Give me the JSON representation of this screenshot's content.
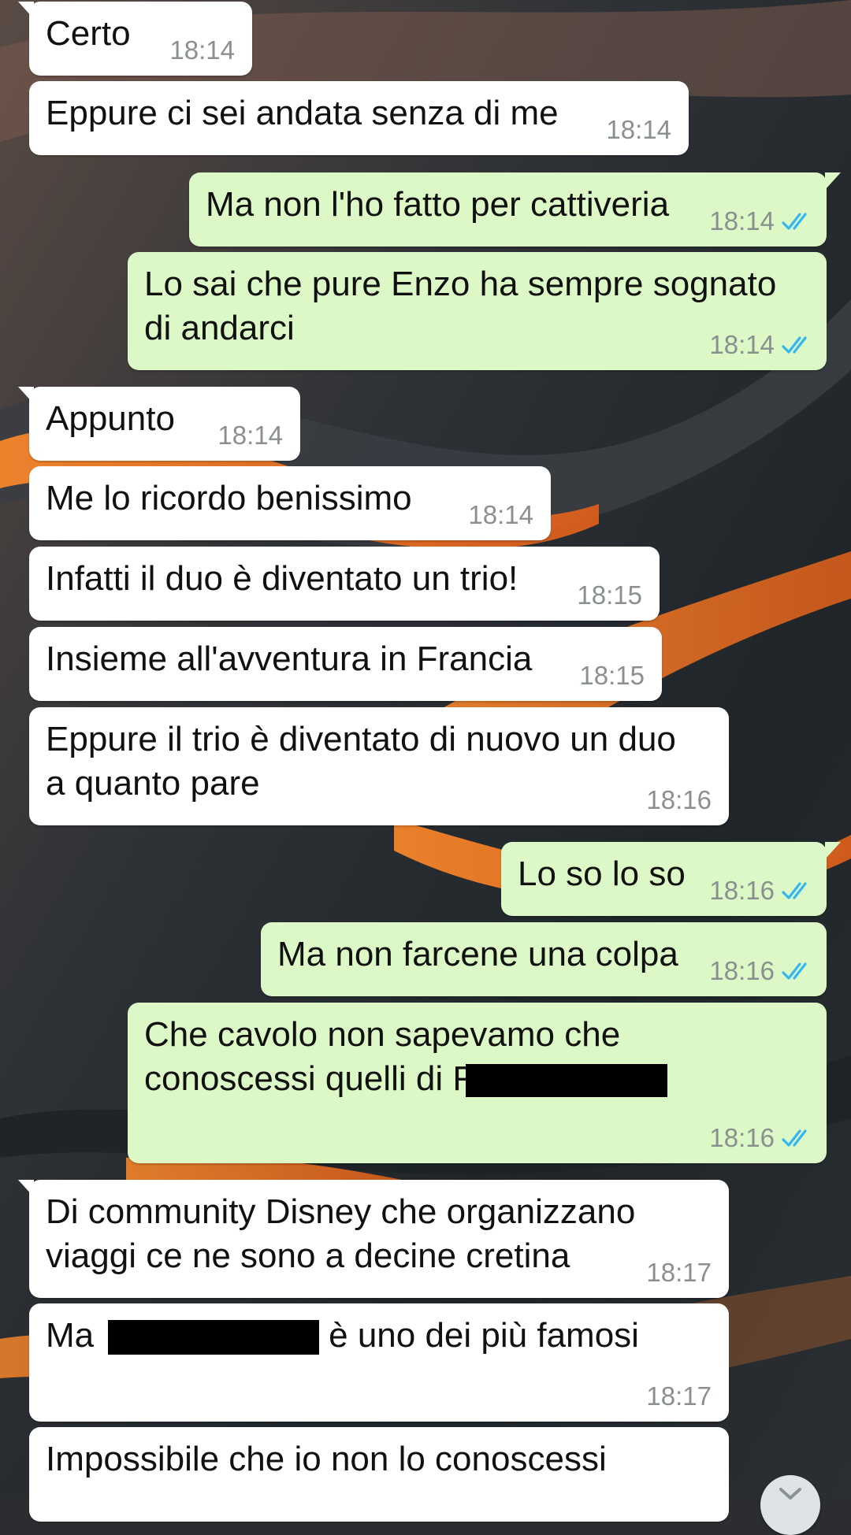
{
  "colors": {
    "incoming_bubble": "#ffffff",
    "outgoing_bubble": "#dcf8c6",
    "timestamp": "#8a8f8f",
    "read_ticks": "#34b7f1"
  },
  "messages": [
    {
      "text": "Certo",
      "time": "18:14",
      "direction": "in"
    },
    {
      "text": "Eppure ci sei andata senza di me",
      "time": "18:14",
      "direction": "in"
    },
    {
      "text": "Ma non l'ho fatto per cattiveria",
      "time": "18:14",
      "direction": "out",
      "status": "read-ticks-icon"
    },
    {
      "line1": "Lo sai che pure Enzo ha sempre sognato",
      "line2": "di andarci",
      "time": "18:14",
      "direction": "out",
      "status": "read-ticks-icon"
    },
    {
      "text": "Appunto",
      "time": "18:14",
      "direction": "in"
    },
    {
      "text": "Me lo ricordo benissimo",
      "time": "18:14",
      "direction": "in"
    },
    {
      "text": "Infatti il duo è diventato un trio!",
      "time": "18:15",
      "direction": "in"
    },
    {
      "text": "Insieme all'avventura in Francia",
      "time": "18:15",
      "direction": "in"
    },
    {
      "line1": "Eppure il trio è diventato di nuovo un duo",
      "line2": "a quanto pare",
      "time": "18:16",
      "direction": "in"
    },
    {
      "text": "Lo so lo so",
      "time": "18:16",
      "direction": "out",
      "status": "read-ticks-icon"
    },
    {
      "text": "Ma non farcene una colpa",
      "time": "18:16",
      "direction": "out",
      "status": "read-ticks-icon"
    },
    {
      "line1": "Che cavolo non sapevamo che",
      "line2": "conoscessi quelli di F",
      "time": "18:16",
      "direction": "out",
      "status": "read-ticks-icon"
    },
    {
      "line1": "Di community Disney che organizzano",
      "line2": "viaggi ce ne sono a decine cretina",
      "time": "18:17",
      "direction": "in"
    },
    {
      "before": "Ma",
      "after": "è uno dei più famosi",
      "time": "18:17",
      "direction": "in"
    },
    {
      "text": "Impossibile che io non lo conoscessi",
      "direction": "in"
    }
  ],
  "controls": {
    "scroll_down_icon": "chevron-down-icon"
  }
}
